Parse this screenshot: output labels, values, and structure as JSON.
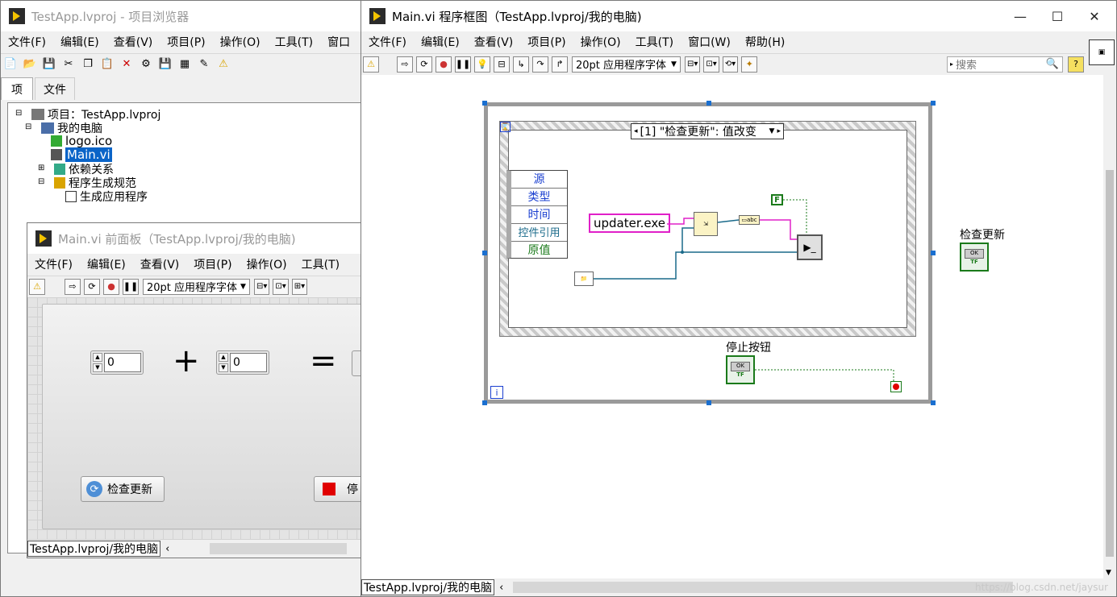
{
  "project_window": {
    "title": "TestApp.lvproj - 项目浏览器",
    "menu": [
      "文件(F)",
      "编辑(E)",
      "查看(V)",
      "项目(P)",
      "操作(O)",
      "工具(T)",
      "窗口"
    ],
    "tabs": [
      "项",
      "文件"
    ],
    "tree": {
      "root": "项目：TestApp.lvproj",
      "my_computer": "我的电脑",
      "logo": "logo.ico",
      "main_vi": "Main.vi",
      "dependencies": "依赖关系",
      "build_specs": "程序生成规范",
      "build_app": "生成应用程序"
    }
  },
  "front_panel": {
    "title": "Main.vi 前面板（TestApp.lvproj/我的电脑)",
    "menu": [
      "文件(F)",
      "编辑(E)",
      "查看(V)",
      "项目(P)",
      "操作(O)",
      "工具(T)"
    ],
    "font": "20pt 应用程序字体",
    "num1": "0",
    "num2": "0",
    "plus": "+",
    "equals": "=",
    "check_update": "检查更新",
    "stop": "停",
    "path": "TestApp.lvproj/我的电脑"
  },
  "block_diagram": {
    "title": "Main.vi 程序框图（TestApp.lvproj/我的电脑)",
    "menu": [
      "文件(F)",
      "编辑(E)",
      "查看(V)",
      "项目(P)",
      "操作(O)",
      "工具(T)",
      "窗口(W)",
      "帮助(H)"
    ],
    "font": "20pt 应用程序字体",
    "search_placeholder": "搜索",
    "event_case": "[1] \"检查更新\": 值改变",
    "event_data": [
      "源",
      "类型",
      "时间",
      "控件引用",
      "原值"
    ],
    "updater": "updater.exe",
    "false_const": "F",
    "stop_label": "停止按钮",
    "check_update_label": "检查更新",
    "ok": "OK",
    "tf": "TF",
    "iter": "i",
    "path": "TestApp.lvproj/我的电脑",
    "watermark": "https://blog.csdn.net/jaysur"
  }
}
